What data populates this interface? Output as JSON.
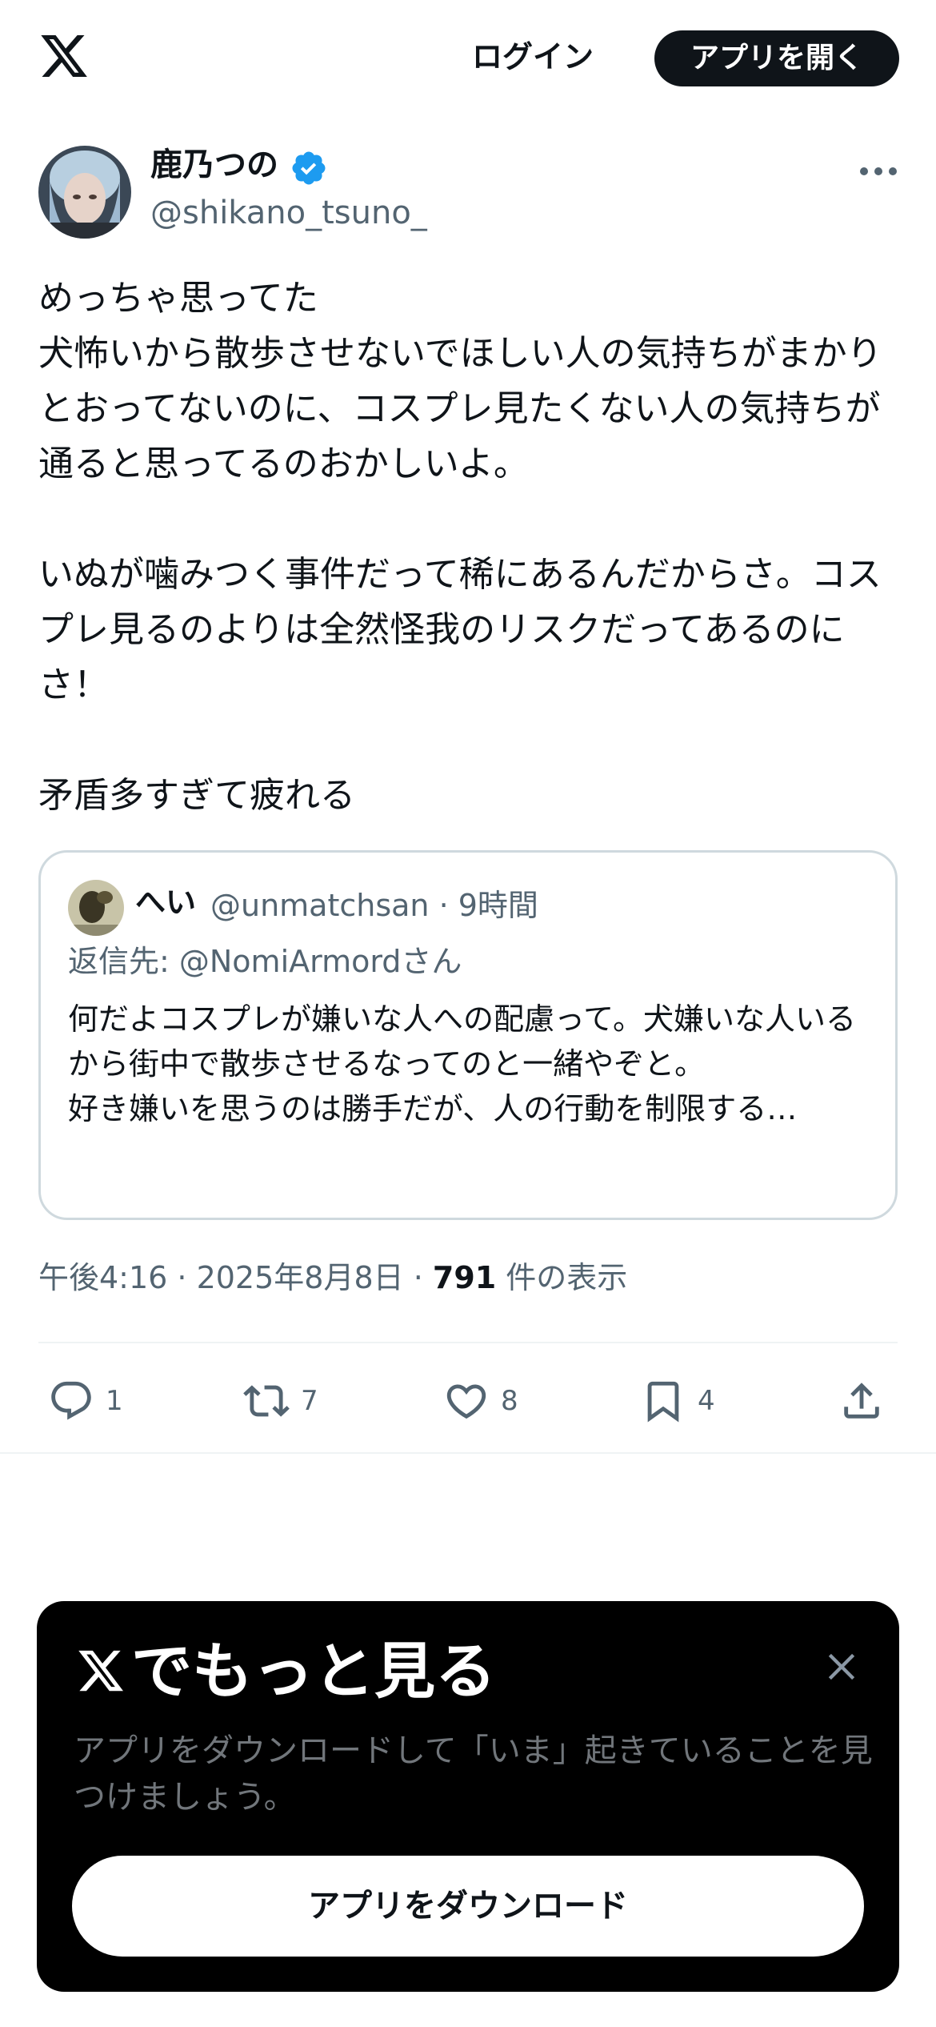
{
  "header": {
    "login_label": "ログイン",
    "open_app_label": "アプリを開く"
  },
  "tweet": {
    "author_name": "鹿乃つの",
    "author_handle": "@shikano_tsuno_",
    "verified": true,
    "text": "めっちゃ思ってた\n犬怖いから散歩させないでほしい人の気持ちがまかりとおってないのに、コスプレ見たくない人の気持ちが通ると思ってるのおかしいよ。\n\nいぬが噛みつく事件だって稀にあるんだからさ。コスプレ見るのよりは全然怪我のリスクだってあるのにさ！\n\n矛盾多すぎて疲れる",
    "time": "午後4:16 · 2025年8月8日 · ",
    "views_count": "791",
    "views_label": " 件の表示"
  },
  "quote": {
    "name": "へい",
    "meta": "@unmatchsan · 9時間",
    "reply_to": "返信先: @NomiArmordさん",
    "text": "何だよコスプレが嫌いな人への配慮って。犬嫌いな人いるから街中で散歩させるなってのと一緒やぞと。\n好き嫌いを思うのは勝手だが、人の行動を制限する…"
  },
  "actions": {
    "reply_count": "1",
    "retweet_count": "7",
    "like_count": "8",
    "bookmark_count": "4"
  },
  "promo": {
    "title": "でもっと見る",
    "description": "アプリをダウンロードして「いま」起きていることを見つけましょう。",
    "button_label": "アプリをダウンロード"
  },
  "colors": {
    "text_primary": "#0f1419",
    "text_secondary": "#536471",
    "verified_blue": "#1d9bf0",
    "border": "#cfd9de",
    "promo_bg": "#000000"
  },
  "icons": [
    "x-logo-icon",
    "verified-badge-icon",
    "more-icon",
    "reply-icon",
    "retweet-icon",
    "like-icon",
    "bookmark-icon",
    "share-icon",
    "close-icon"
  ]
}
